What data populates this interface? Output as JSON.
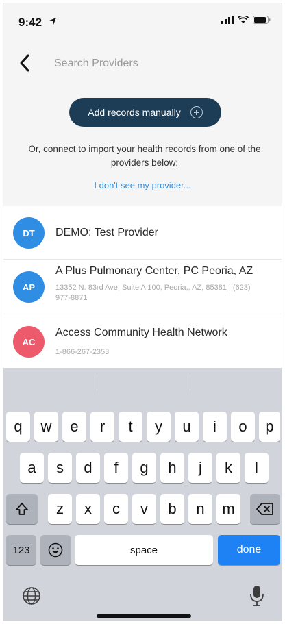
{
  "status": {
    "time": "9:42"
  },
  "header": {
    "search_placeholder": "Search Providers"
  },
  "add_records": {
    "label": "Add records manually"
  },
  "connect_text": "Or, connect to import your health records from one of the providers below:",
  "no_provider_link": "I don't see my provider...",
  "providers": [
    {
      "initials": "DT",
      "name": "DEMO: Test Provider",
      "detail": "",
      "color": "#2f8de4"
    },
    {
      "initials": "AP",
      "name": "A Plus Pulmonary Center, PC Peoria, AZ",
      "detail": "13352 N. 83rd Ave, Suite A 100, Peoria,, AZ, 85381 | (623) 977-8871",
      "color": "#2f8de4"
    },
    {
      "initials": "AC",
      "name": "Access Community Health Network",
      "detail": "1-866-267-2353",
      "color": "#ec5a6b"
    }
  ],
  "keyboard": {
    "row1": [
      "q",
      "w",
      "e",
      "r",
      "t",
      "y",
      "u",
      "i",
      "o",
      "p"
    ],
    "row2": [
      "a",
      "s",
      "d",
      "f",
      "g",
      "h",
      "j",
      "k",
      "l"
    ],
    "row3": [
      "z",
      "x",
      "c",
      "v",
      "b",
      "n",
      "m"
    ],
    "numbers_label": "123",
    "space_label": "space",
    "done_label": "done"
  },
  "icons": {
    "back": "chevron-left-icon",
    "shift": "shift-icon",
    "delete": "delete-icon",
    "emoji": "emoji-icon",
    "globe": "globe-icon",
    "mic": "mic-icon"
  }
}
